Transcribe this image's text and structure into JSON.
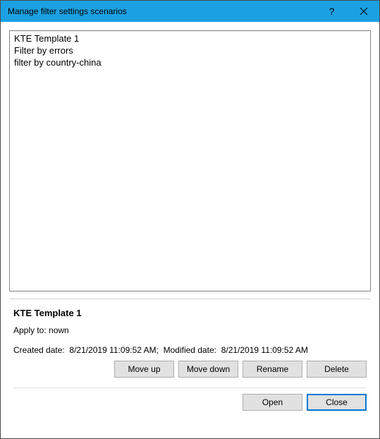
{
  "titlebar": {
    "title": "Manage filter settings scenarios",
    "help": "?",
    "close": "×"
  },
  "list": {
    "items": [
      "KTE Template 1",
      "Filter by errors",
      "filter by country-china"
    ]
  },
  "details": {
    "title": "KTE Template 1",
    "apply_label": "Apply to:",
    "apply_value": "nown",
    "created_label": "Created date:",
    "created_value": "8/21/2019 11:09:52 AM",
    "separator": ";",
    "modified_label": "Modified date:",
    "modified_value": "8/21/2019 11:09:52 AM"
  },
  "buttons": {
    "move_up": "Move up",
    "move_down": "Move down",
    "rename": "Rename",
    "delete": "Delete",
    "open": "Open",
    "close": "Close"
  }
}
